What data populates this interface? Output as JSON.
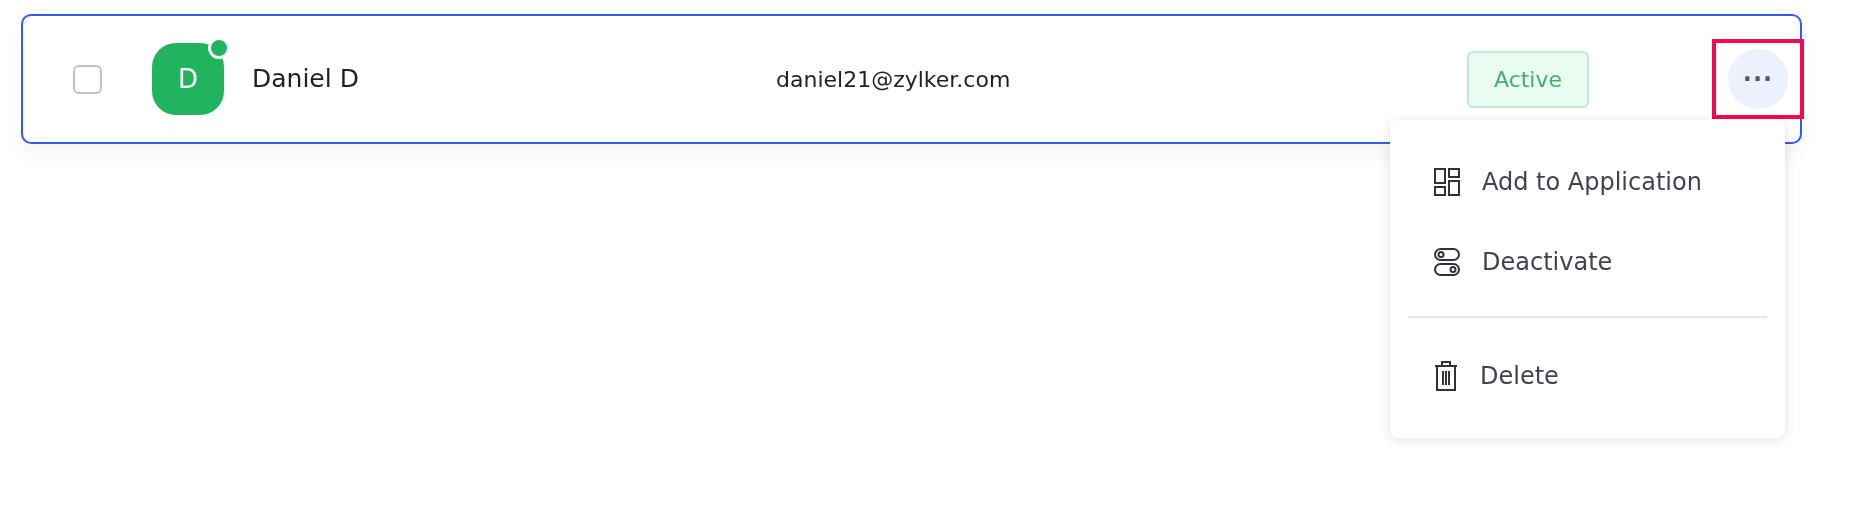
{
  "user_row": {
    "checked": false,
    "avatar": {
      "letter": "D",
      "online": true
    },
    "name": "Daniel D",
    "email": "daniel21@zylker.com",
    "status": {
      "label": "Active",
      "kind": "active"
    },
    "more_button": {
      "label": "···",
      "highlighted": true
    }
  },
  "menu": {
    "groups": [
      [
        {
          "label": "Add to Application",
          "kind": "apps"
        },
        {
          "label": "Deactivate",
          "kind": "toggle"
        }
      ],
      [
        {
          "label": "Delete",
          "kind": "trash"
        }
      ]
    ]
  }
}
